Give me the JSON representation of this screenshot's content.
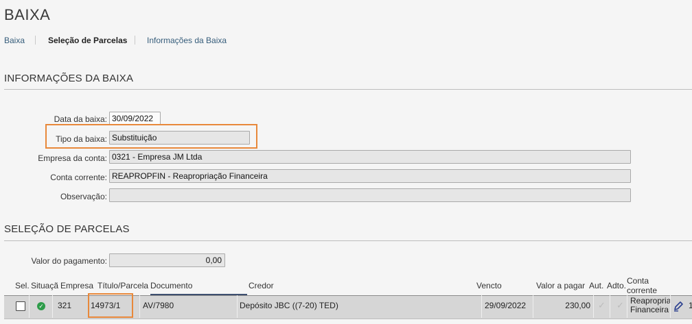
{
  "page": {
    "title": "BAIXA"
  },
  "breadcrumb": {
    "items": [
      {
        "label": "Baixa"
      },
      {
        "label": "Seleção de Parcelas"
      },
      {
        "label": "Informações da Baixa"
      }
    ]
  },
  "info": {
    "heading": "INFORMAÇÕES DA BAIXA",
    "data_baixa": {
      "label": "Data da baixa:",
      "value": "30/09/2022"
    },
    "tipo_baixa": {
      "label": "Tipo da baixa:",
      "value": "Substituição"
    },
    "empresa_conta": {
      "label": "Empresa da conta:",
      "value": "0321 - Empresa JM Ltda"
    },
    "conta_corrente": {
      "label": "Conta corrente:",
      "value": "REAPROPFIN - Reapropriação Financeira"
    },
    "observacao": {
      "label": "Observação:",
      "value": ""
    }
  },
  "selecao": {
    "heading": "SELEÇÃO DE PARCELAS",
    "valor_pagamento": {
      "label": "Valor do pagamento:",
      "value": "0,00"
    },
    "columns": [
      "Sel.",
      "Situaçã",
      "Empresa",
      "Título/Parcela",
      "Documento",
      "Credor",
      "Vencto",
      "Valor a pagar",
      "Aut.",
      "Adto.",
      "Conta",
      "corrente"
    ],
    "rows": [
      {
        "empresa": "321",
        "titulo": "14973/1",
        "documento": "AV/7980",
        "credor": "Depósito JBC ((7-20) TED)",
        "vencto": "29/09/2022",
        "valor": "230,00",
        "conta_l1": "Reapropriaç",
        "conta_l2": "Financeira",
        "extra": "1"
      }
    ]
  },
  "colors": {
    "highlight": "#e8883a",
    "ok": "#2e9c4a",
    "link": "#355c7a"
  }
}
